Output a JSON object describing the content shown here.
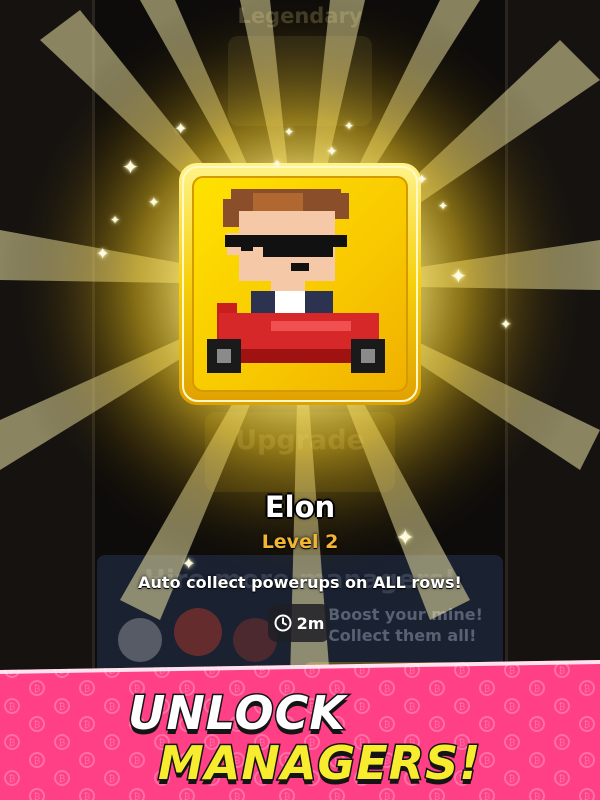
{
  "background": {
    "rarity_title": "Legendary",
    "upgrade_label": "Upgrade",
    "hire_title": "Hire more managers!",
    "boost_line_1": "Boost your mine!",
    "boost_line_2": "Collect them all!"
  },
  "manager": {
    "name": "Elon",
    "level": "Level 2",
    "ability": "Auto collect powerups on ALL rows!",
    "duration": "2m",
    "portrait": "pixel-man-sunglasses-red-kart-icon"
  },
  "promo": {
    "line_1": "UNLOCK",
    "line_2": "MANAGERS!",
    "banner_color": "#ff3f86"
  },
  "colors": {
    "card_gold": "#f7cf0b",
    "level_text": "#f2b632",
    "headline_yellow": "#f7ec2e"
  }
}
